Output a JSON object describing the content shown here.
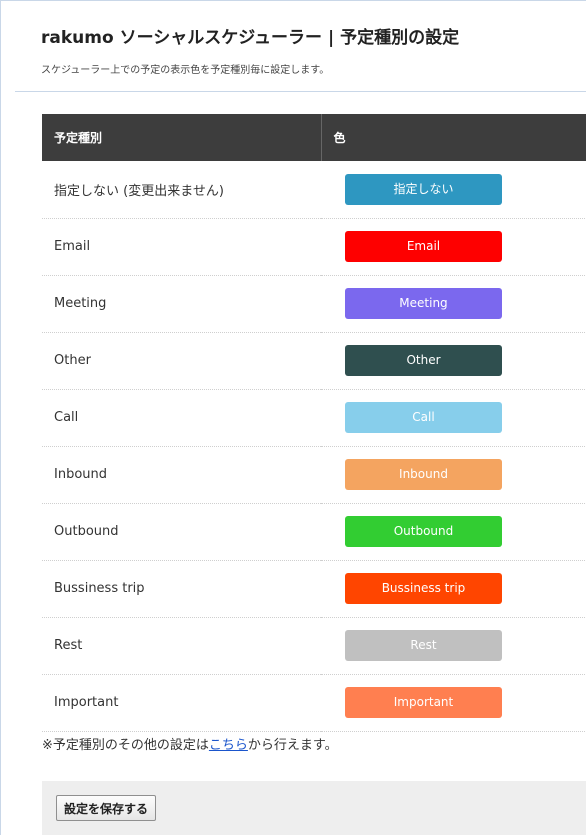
{
  "header": {
    "title": "rakumo ソーシャルスケジューラー | 予定種別の設定",
    "subtitle": "スケジューラー上での予定の表示色を予定種別毎に設定します。"
  },
  "table": {
    "columns": [
      "予定種別",
      "色"
    ],
    "rows": [
      {
        "type": "指定しない (変更出来ません)",
        "chip_label": "指定しない",
        "color": "#2e97c1",
        "text_color": "#ffffff"
      },
      {
        "type": "Email",
        "chip_label": "Email",
        "color": "#fe0000",
        "text_color": "#ffffff"
      },
      {
        "type": "Meeting",
        "chip_label": "Meeting",
        "color": "#7b68ee",
        "text_color": "#ffffff"
      },
      {
        "type": "Other",
        "chip_label": "Other",
        "color": "#2f4f4f",
        "text_color": "#ffffff"
      },
      {
        "type": "Call",
        "chip_label": "Call",
        "color": "#87ceeb",
        "text_color": "#ffffff"
      },
      {
        "type": "Inbound",
        "chip_label": "Inbound",
        "color": "#f4a460",
        "text_color": "#ffffff"
      },
      {
        "type": "Outbound",
        "chip_label": "Outbound",
        "color": "#32cd32",
        "text_color": "#ffffff"
      },
      {
        "type": "Bussiness trip",
        "chip_label": "Bussiness trip",
        "color": "#ff4500",
        "text_color": "#ffffff"
      },
      {
        "type": "Rest",
        "chip_label": "Rest",
        "color": "#c0c0c0",
        "text_color": "#ffffff"
      },
      {
        "type": "Important",
        "chip_label": "Important",
        "color": "#ff7f50",
        "text_color": "#ffffff"
      }
    ]
  },
  "note": {
    "prefix": "※予定種別のその他の設定は",
    "link_text": "こちら",
    "suffix": "から行えます。"
  },
  "footer": {
    "save_label": "設定を保存する"
  }
}
